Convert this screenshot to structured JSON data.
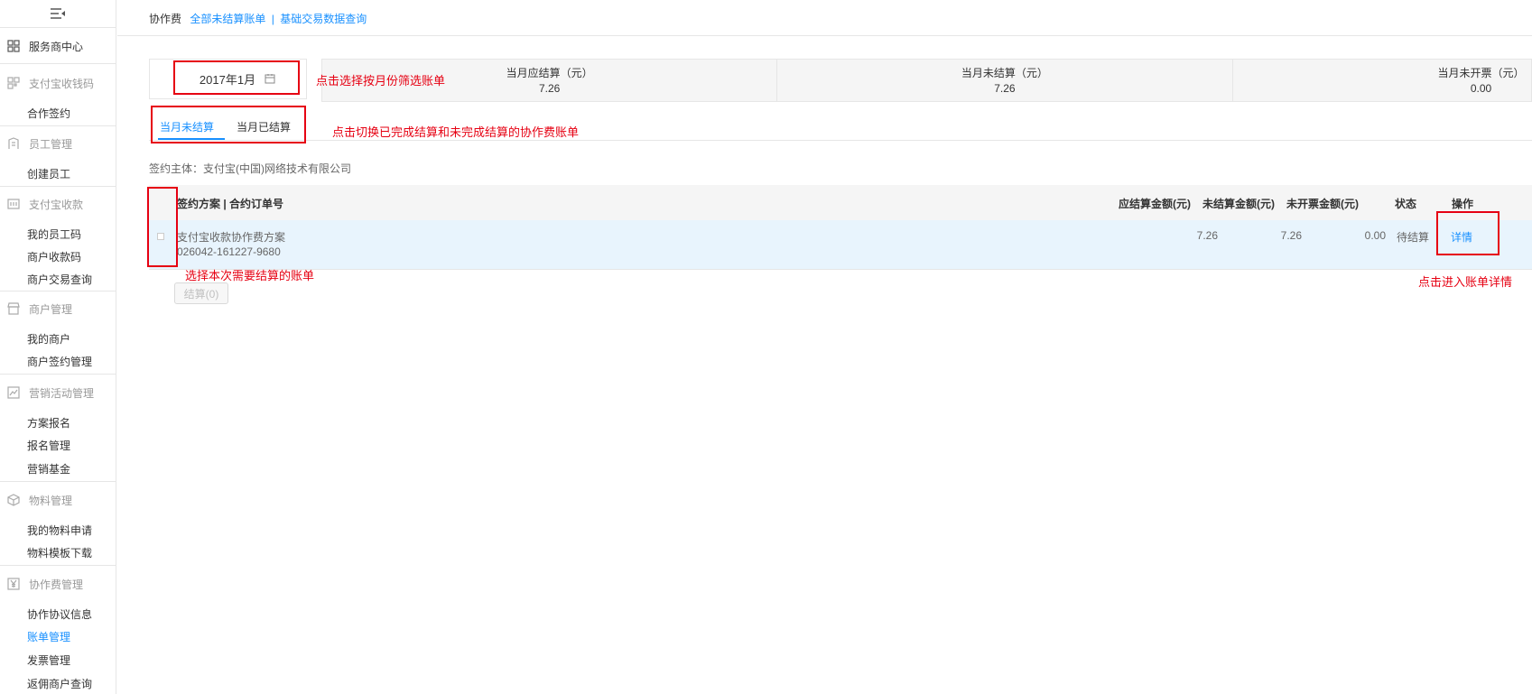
{
  "sidebar": {
    "service_center": "服务商中心",
    "groups": [
      {
        "title": "支付宝收钱码",
        "items": [
          "合作签约"
        ]
      },
      {
        "title": "员工管理",
        "items": [
          "创建员工"
        ]
      },
      {
        "title": "支付宝收款",
        "items": [
          "我的员工码",
          "商户收款码",
          "商户交易查询"
        ]
      },
      {
        "title": "商户管理",
        "items": [
          "我的商户",
          "商户签约管理"
        ]
      },
      {
        "title": "营销活动管理",
        "items": [
          "方案报名",
          "报名管理",
          "营销基金"
        ]
      },
      {
        "title": "物料管理",
        "items": [
          "我的物料申请",
          "物料模板下载"
        ]
      },
      {
        "title": "协作费管理",
        "items": [
          "协作协议信息",
          "账单管理",
          "发票管理",
          "返佣商户查询"
        ]
      }
    ]
  },
  "breadcrumb": {
    "title": "协作费",
    "link1": "全部未结算账单",
    "separator": "|",
    "link2": "基础交易数据查询"
  },
  "month_picker": {
    "value": "2017年1月"
  },
  "summary": [
    {
      "label": "当月应结算（元）",
      "value": "7.26"
    },
    {
      "label": "当月未结算（元）",
      "value": "7.26"
    },
    {
      "label": "当月未开票（元）",
      "value": "0.00"
    }
  ],
  "tabs": {
    "unsettled": "当月未结算",
    "settled": "当月已结算"
  },
  "entity_label": "签约主体：支付宝(中国)网络技术有限公司",
  "table": {
    "headers": {
      "plan": "签约方案 | 合约订单号",
      "due": "应结算金额(元)",
      "unsettled": "未结算金额(元)",
      "uninvoiced": "未开票金额(元)",
      "status": "状态",
      "action": "操作"
    },
    "rows": [
      {
        "plan": "支付宝收款协作费方案",
        "order": "026042-161227-9680",
        "due": "7.26",
        "unsettled": "7.26",
        "uninvoiced": "0.00",
        "status": "待结算",
        "action": "详情"
      }
    ]
  },
  "settle_button": "结算(0)",
  "annotations": {
    "month": "点击选择按月份筛选账单",
    "tabs": "点击切换已完成结算和未完成结算的协作费账单",
    "checkbox": "选择本次需要结算的账单",
    "detail": "点击进入账单详情"
  },
  "colors": {
    "accent": "#1890ff",
    "annotation": "#e60012",
    "header_bg": "#f5f5f5",
    "row_bg": "#e8f4fd"
  }
}
